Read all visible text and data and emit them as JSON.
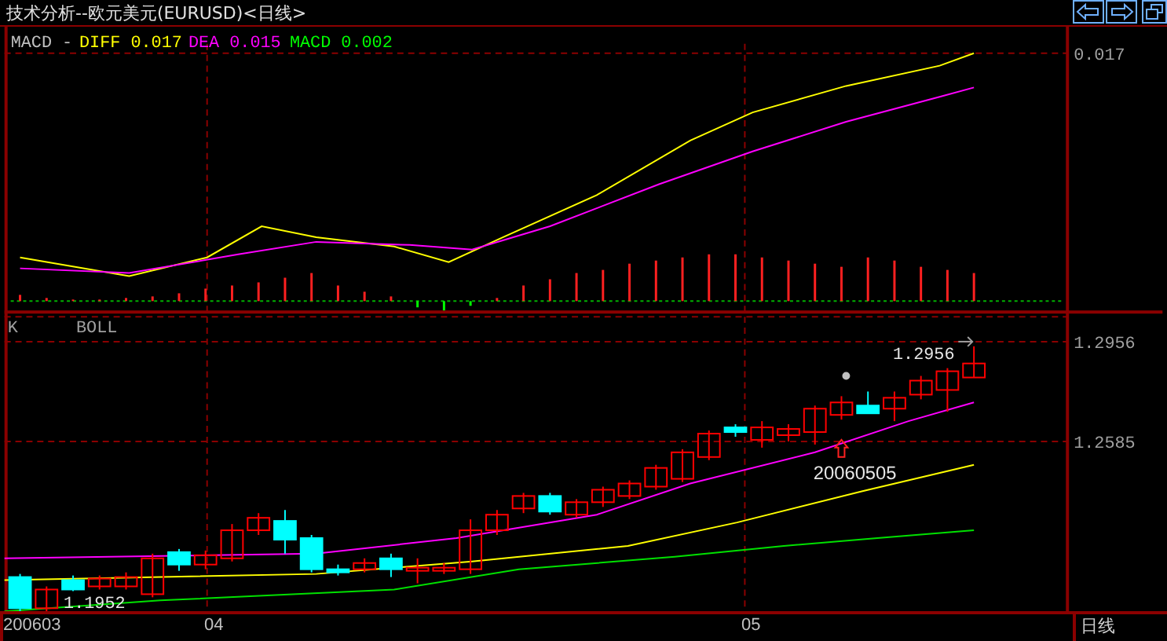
{
  "window": {
    "title": "技术分析--欧元美元(EURUSD)<日线>"
  },
  "macd_panel": {
    "legend": [
      {
        "text": "MACD -",
        "color": "#c0c0c0"
      },
      {
        "text": "DIFF",
        "value": "0.017",
        "color": "#ffff00"
      },
      {
        "text": "DEA",
        "value": "0.015",
        "color": "#ff00ff"
      },
      {
        "text": "MACD",
        "value": "0.002",
        "color": "#00ff00"
      }
    ],
    "axis_labels": [
      "0.017"
    ]
  },
  "k_panel": {
    "labels": [
      "K",
      "BOLL"
    ],
    "axis_labels": [
      "1.2956",
      "1.2585"
    ],
    "high_marker": "1.2956",
    "low_marker": "1.1952",
    "date_marker": "20060505"
  },
  "x_axis": {
    "labels": [
      "200603",
      "04",
      "05"
    ],
    "period": "日线"
  }
}
